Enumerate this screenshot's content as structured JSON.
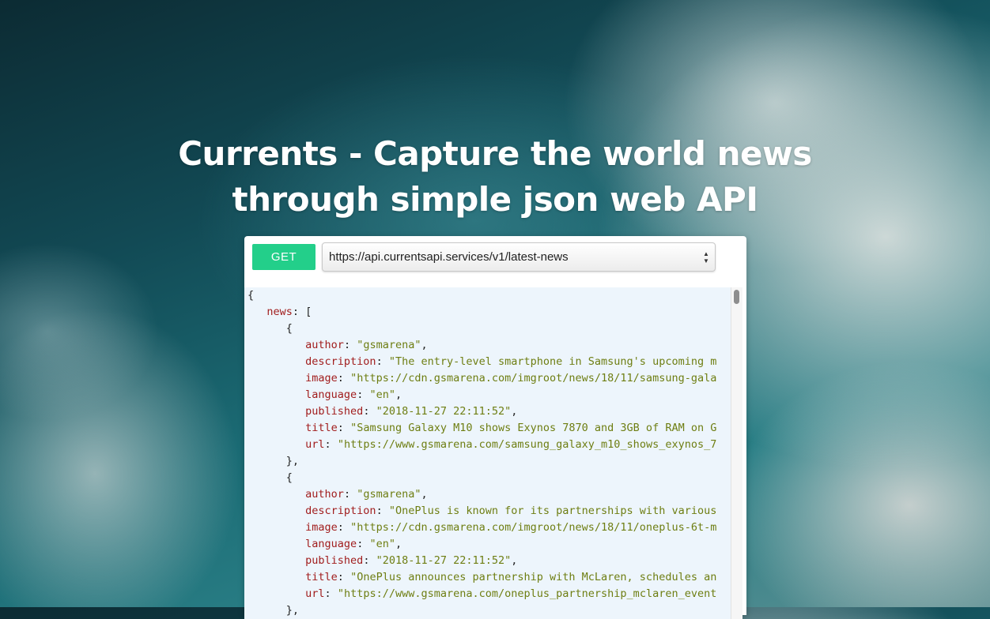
{
  "hero": {
    "title_line1": "Currents - Capture the world news",
    "title_line2": "through simple json web API"
  },
  "request": {
    "method_label": "GET",
    "endpoint": "https://api.currentsapi.services/v1/latest-news"
  },
  "response": {
    "lines": [
      {
        "indent": 0,
        "parts": [
          {
            "t": "p",
            "v": "{"
          }
        ]
      },
      {
        "indent": 1,
        "parts": [
          {
            "t": "k",
            "v": "news"
          },
          {
            "t": "p",
            "v": ": ["
          }
        ]
      },
      {
        "indent": 2,
        "parts": [
          {
            "t": "p",
            "v": "{"
          }
        ]
      },
      {
        "indent": 3,
        "parts": [
          {
            "t": "k",
            "v": "author"
          },
          {
            "t": "p",
            "v": ": "
          },
          {
            "t": "s",
            "v": "\"gsmarena\""
          },
          {
            "t": "p",
            "v": ","
          }
        ]
      },
      {
        "indent": 3,
        "parts": [
          {
            "t": "k",
            "v": "description"
          },
          {
            "t": "p",
            "v": ": "
          },
          {
            "t": "s",
            "v": "\"The entry-level smartphone in Samsung's upcoming m"
          }
        ]
      },
      {
        "indent": 3,
        "parts": [
          {
            "t": "k",
            "v": "image"
          },
          {
            "t": "p",
            "v": ": "
          },
          {
            "t": "s",
            "v": "\"https://cdn.gsmarena.com/imgroot/news/18/11/samsung-gala"
          }
        ]
      },
      {
        "indent": 3,
        "parts": [
          {
            "t": "k",
            "v": "language"
          },
          {
            "t": "p",
            "v": ": "
          },
          {
            "t": "s",
            "v": "\"en\""
          },
          {
            "t": "p",
            "v": ","
          }
        ]
      },
      {
        "indent": 3,
        "parts": [
          {
            "t": "k",
            "v": "published"
          },
          {
            "t": "p",
            "v": ": "
          },
          {
            "t": "s",
            "v": "\"2018-11-27 22:11:52\""
          },
          {
            "t": "p",
            "v": ","
          }
        ]
      },
      {
        "indent": 3,
        "parts": [
          {
            "t": "k",
            "v": "title"
          },
          {
            "t": "p",
            "v": ": "
          },
          {
            "t": "s",
            "v": "\"Samsung Galaxy M10 shows Exynos 7870 and 3GB of RAM on G"
          }
        ]
      },
      {
        "indent": 3,
        "parts": [
          {
            "t": "k",
            "v": "url"
          },
          {
            "t": "p",
            "v": ": "
          },
          {
            "t": "s",
            "v": "\"https://www.gsmarena.com/samsung_galaxy_m10_shows_exynos_7"
          }
        ]
      },
      {
        "indent": 2,
        "parts": [
          {
            "t": "p",
            "v": "},"
          }
        ]
      },
      {
        "indent": 2,
        "parts": [
          {
            "t": "p",
            "v": "{"
          }
        ]
      },
      {
        "indent": 3,
        "parts": [
          {
            "t": "k",
            "v": "author"
          },
          {
            "t": "p",
            "v": ": "
          },
          {
            "t": "s",
            "v": "\"gsmarena\""
          },
          {
            "t": "p",
            "v": ","
          }
        ]
      },
      {
        "indent": 3,
        "parts": [
          {
            "t": "k",
            "v": "description"
          },
          {
            "t": "p",
            "v": ": "
          },
          {
            "t": "s",
            "v": "\"OnePlus is known for its partnerships with various"
          }
        ]
      },
      {
        "indent": 3,
        "parts": [
          {
            "t": "k",
            "v": "image"
          },
          {
            "t": "p",
            "v": ": "
          },
          {
            "t": "s",
            "v": "\"https://cdn.gsmarena.com/imgroot/news/18/11/oneplus-6t-m"
          }
        ]
      },
      {
        "indent": 3,
        "parts": [
          {
            "t": "k",
            "v": "language"
          },
          {
            "t": "p",
            "v": ": "
          },
          {
            "t": "s",
            "v": "\"en\""
          },
          {
            "t": "p",
            "v": ","
          }
        ]
      },
      {
        "indent": 3,
        "parts": [
          {
            "t": "k",
            "v": "published"
          },
          {
            "t": "p",
            "v": ": "
          },
          {
            "t": "s",
            "v": "\"2018-11-27 22:11:52\""
          },
          {
            "t": "p",
            "v": ","
          }
        ]
      },
      {
        "indent": 3,
        "parts": [
          {
            "t": "k",
            "v": "title"
          },
          {
            "t": "p",
            "v": ": "
          },
          {
            "t": "s",
            "v": "\"OnePlus announces partnership with McLaren, schedules an"
          }
        ]
      },
      {
        "indent": 3,
        "parts": [
          {
            "t": "k",
            "v": "url"
          },
          {
            "t": "p",
            "v": ": "
          },
          {
            "t": "s",
            "v": "\"https://www.gsmarena.com/oneplus_partnership_mclaren_event"
          }
        ]
      },
      {
        "indent": 2,
        "parts": [
          {
            "t": "p",
            "v": "},"
          }
        ]
      }
    ]
  },
  "colors": {
    "method_button": "#23cf8a",
    "json_key": "#a11d1d",
    "json_string": "#6e7e12",
    "code_background": "#edf5fc"
  },
  "icons": {
    "select_arrows": "up-down-chevron-icon"
  }
}
